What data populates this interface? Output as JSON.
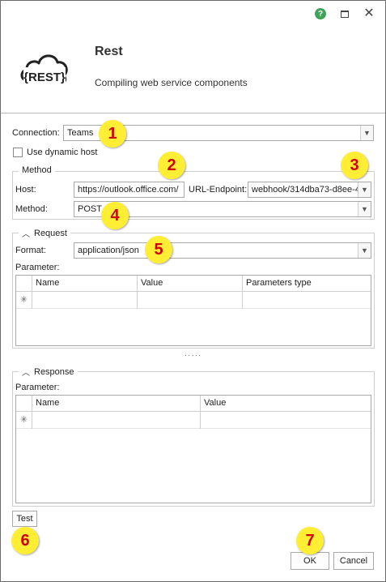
{
  "window": {
    "help_label": "?",
    "max_label": "",
    "close_label": "✕"
  },
  "header": {
    "logo_text": "{REST}",
    "title": "Rest",
    "subtitle": "Compiling web service components"
  },
  "connection": {
    "label": "Connection:",
    "value": "Teams",
    "dynamic_host_label": "Use dynamic host",
    "dynamic_host_checked": false
  },
  "method_group": {
    "title": "Method",
    "host_label": "Host:",
    "host_value": "https://outlook.office.com/",
    "endpoint_label": "URL-Endpoint:",
    "endpoint_value": "webhook/314dba73-d8ee-4",
    "method_label": "Method:",
    "method_value": "POST"
  },
  "request": {
    "title": "Request",
    "format_label": "Format:",
    "format_value": "application/json",
    "parameter_label": "Parameter:",
    "columns": [
      "Name",
      "Value",
      "Parameters type"
    ],
    "new_row_marker": "✳"
  },
  "splitter_text": "·····",
  "response": {
    "title": "Response",
    "parameter_label": "Parameter:",
    "columns": [
      "Name",
      "Value"
    ],
    "new_row_marker": "✳"
  },
  "buttons": {
    "test": "Test",
    "ok": "OK",
    "cancel": "Cancel"
  },
  "badges": [
    "1",
    "2",
    "3",
    "4",
    "5",
    "6",
    "7"
  ],
  "colors": {
    "badge_fill": "#ffee33",
    "badge_text": "#d20000",
    "help_icon": "#3fa35a"
  }
}
